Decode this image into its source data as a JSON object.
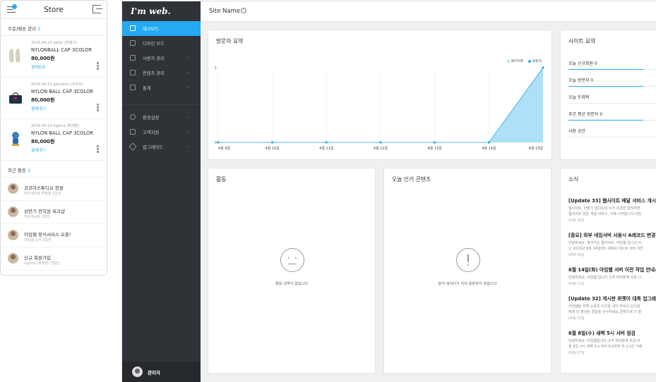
{
  "mobile": {
    "title": "Store",
    "notification_badge": "",
    "orders_section": {
      "label": "주문/배송 관리",
      "count": "5"
    },
    "orders": [
      {
        "meta": "2016.04.13   sailor (유정구)",
        "name": "NYLONBALL CAP 3COLOR",
        "price": "80,000원",
        "status": "결제완료",
        "image": "sneakers"
      },
      {
        "meta": "2016.04.13   getsumo (이수오)",
        "name": "NYLON BALL CAP 3COLOR",
        "price": "80,000원",
        "status": "결제대기",
        "image": "bag"
      },
      {
        "meta": "2016.04.13   highca (박재환)",
        "name": "NYLON BALL CAP 3COLOR",
        "price": "80,000원",
        "status": "결제대기",
        "image": "figure"
      }
    ],
    "activity_section": {
      "label": "최근 활동",
      "count": "2"
    },
    "activities": [
      {
        "title": "코코아스튜디오 창원",
        "sub": "자유게시판   박영호   1일전"
      },
      {
        "title": "상반기 전직원 워크샵",
        "sub": "자유게시판   2일전"
      },
      {
        "title": "아임웹 정식서비스 오픈!",
        "sub": "아임웹 소식   3일전"
      },
      {
        "title": "신규 회원가입",
        "sub": "highca (박재환)   3일전"
      }
    ]
  },
  "admin": {
    "logo": "I'm web.",
    "site_name": "Site Name",
    "info_glyph": "i",
    "nav": [
      {
        "label": "대시보드",
        "icon": "home-icon",
        "active": true,
        "chevron": ""
      },
      {
        "label": "디자인 모드",
        "icon": "brush-icon",
        "active": false,
        "chevron": ""
      },
      {
        "label": "사용자 관리",
        "icon": "user-icon",
        "active": false,
        "chevron": "⌄"
      },
      {
        "label": "컨텐츠 관리",
        "icon": "inbox-icon",
        "active": false,
        "chevron": "⌄"
      },
      {
        "label": "통계",
        "icon": "stats-icon",
        "active": false,
        "chevron": "⌄"
      },
      {
        "label": "환경설정",
        "icon": "gear-icon",
        "active": false,
        "chevron": "⌄"
      },
      {
        "label": "고객지원",
        "icon": "support-icon",
        "active": false,
        "chevron": "⌄"
      },
      {
        "label": "업그레이드",
        "icon": "plane-icon",
        "active": false,
        "chevron": "⌄"
      }
    ],
    "user_name": "관리자",
    "visitor_summary": {
      "title": "방문자 요약",
      "legend": [
        {
          "label": "페이지뷰",
          "color": "#aee0f8"
        },
        {
          "label": "방문자",
          "color": "#24a9f2"
        }
      ]
    },
    "site_summary": {
      "title": "사이트 요약",
      "stats": [
        {
          "label": "오늘 신규회원 0",
          "fill": 0.85
        },
        {
          "label": "오늘 방문자 0",
          "fill": 0.85
        },
        {
          "label": "오늘 트래픽",
          "fill": 0
        },
        {
          "label": "주간 평균 방문자 0",
          "fill": 0.85
        },
        {
          "label": "사용 공간",
          "fill": 0
        }
      ]
    },
    "activity_card": {
      "title": "활동",
      "empty": "활동 내역이 없습니다"
    },
    "popular_card": {
      "title": "오늘 인기 콘텐츠",
      "empty": "분석 데이터가 아직 충분하지 않습니다"
    },
    "news_card": {
      "title": "소식",
      "items": [
        {
          "title": "[Update 33] 웹사이트 배달 서비스 개시 및",
          "body": [
            "웹사이트, 만들기 쉽다는데 누가 조금만 알려주면",
            "웹사이트 방문 개설 서비스. 이제 시작합니다 아임"
          ],
          "date": "06월 16일"
        },
        {
          "title": "[중요] 외부 네임서버 사용시 A레코드 변경",
          "body": [
            "안녕하세요. 찾아가는 웹사이트, 아임웹 입니다.이",
            "난 2016년 6월 14일(화) 새로운 IDC로 서버 이전"
          ],
          "date": "06월 16일"
        },
        {
          "title": "6월 14일(화) 아임웹 서버 이전 작업 안내사",
          "body": [
            "안녕하세요, 아임웹 입니다.고객 여러분께 더욱 나"
          ],
          "date": "06월 13일"
        },
        {
          "title": "[Update 32] 게시판 위젯이 대폭 업그레이",
          "body": [
            "아임웹을 위해 소중한 시간을 내어 주셔서 감사합",
            "에게 더 향상된 경험을 선사하세요.콘텐츠에 더 잘"
          ],
          "date": "06월 10일"
        },
        {
          "title": "6월 8일(수) 새벽 5시 서버 점검",
          "body": [
            "안녕하세요. 아임웹입니다.고객 여러분께 조금 더",
            "월 8일 (수) 새벽 5시 부터 6시까지 약 1시간 가량"
          ],
          "date": "06월 07일"
        }
      ]
    }
  },
  "chart_data": {
    "type": "area",
    "x": [
      "4월 9일",
      "4월 10일",
      "4월 11일",
      "4월 12일",
      "4월 13일",
      "4월 14일",
      "4월 15일"
    ],
    "series": [
      {
        "name": "페이지뷰",
        "values": [
          0,
          0,
          0,
          0,
          0,
          0,
          1
        ]
      },
      {
        "name": "방문자",
        "values": [
          0,
          0,
          0,
          0,
          0,
          0,
          1
        ]
      }
    ],
    "yticks": [
      "0",
      "1"
    ],
    "ylim": [
      0,
      1
    ],
    "grid": true,
    "legend": "top-right"
  }
}
